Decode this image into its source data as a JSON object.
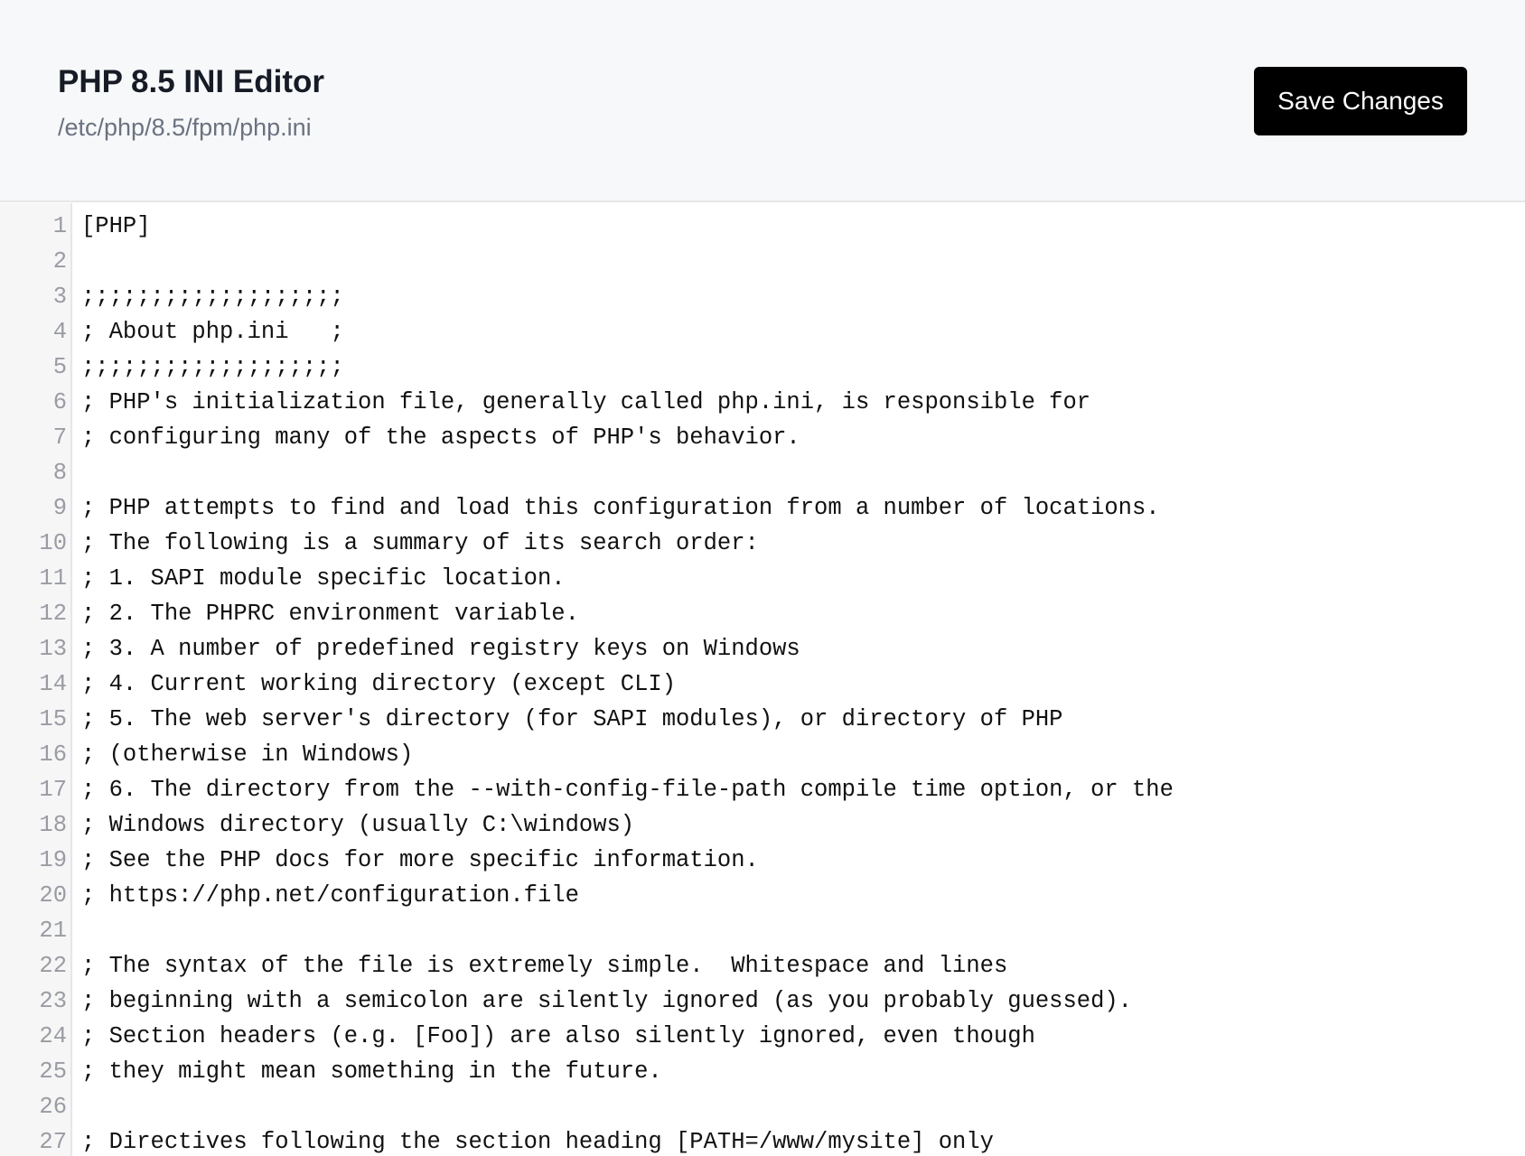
{
  "header": {
    "title": "PHP 8.5 INI Editor",
    "file_path": "/etc/php/8.5/fpm/php.ini",
    "save_label": "Save Changes"
  },
  "editor": {
    "lines": [
      {
        "n": "1",
        "text": "[PHP]"
      },
      {
        "n": "2",
        "text": ""
      },
      {
        "n": "3",
        "text": ";;;;;;;;;;;;;;;;;;;"
      },
      {
        "n": "4",
        "text": "; About php.ini   ;"
      },
      {
        "n": "5",
        "text": ";;;;;;;;;;;;;;;;;;;"
      },
      {
        "n": "6",
        "text": "; PHP's initialization file, generally called php.ini, is responsible for"
      },
      {
        "n": "7",
        "text": "; configuring many of the aspects of PHP's behavior."
      },
      {
        "n": "8",
        "text": ""
      },
      {
        "n": "9",
        "text": "; PHP attempts to find and load this configuration from a number of locations."
      },
      {
        "n": "10",
        "text": "; The following is a summary of its search order:"
      },
      {
        "n": "11",
        "text": "; 1. SAPI module specific location."
      },
      {
        "n": "12",
        "text": "; 2. The PHPRC environment variable."
      },
      {
        "n": "13",
        "text": "; 3. A number of predefined registry keys on Windows"
      },
      {
        "n": "14",
        "text": "; 4. Current working directory (except CLI)"
      },
      {
        "n": "15",
        "text": "; 5. The web server's directory (for SAPI modules), or directory of PHP"
      },
      {
        "n": "16",
        "text": "; (otherwise in Windows)"
      },
      {
        "n": "17",
        "text": "; 6. The directory from the --with-config-file-path compile time option, or the"
      },
      {
        "n": "18",
        "text": "; Windows directory (usually C:\\windows)"
      },
      {
        "n": "19",
        "text": "; See the PHP docs for more specific information."
      },
      {
        "n": "20",
        "text": "; https://php.net/configuration.file"
      },
      {
        "n": "21",
        "text": ""
      },
      {
        "n": "22",
        "text": "; The syntax of the file is extremely simple.  Whitespace and lines"
      },
      {
        "n": "23",
        "text": "; beginning with a semicolon are silently ignored (as you probably guessed)."
      },
      {
        "n": "24",
        "text": "; Section headers (e.g. [Foo]) are also silently ignored, even though"
      },
      {
        "n": "25",
        "text": "; they might mean something in the future."
      },
      {
        "n": "26",
        "text": ""
      },
      {
        "n": "27",
        "text": "; Directives following the section heading [PATH=/www/mysite] only"
      }
    ]
  }
}
